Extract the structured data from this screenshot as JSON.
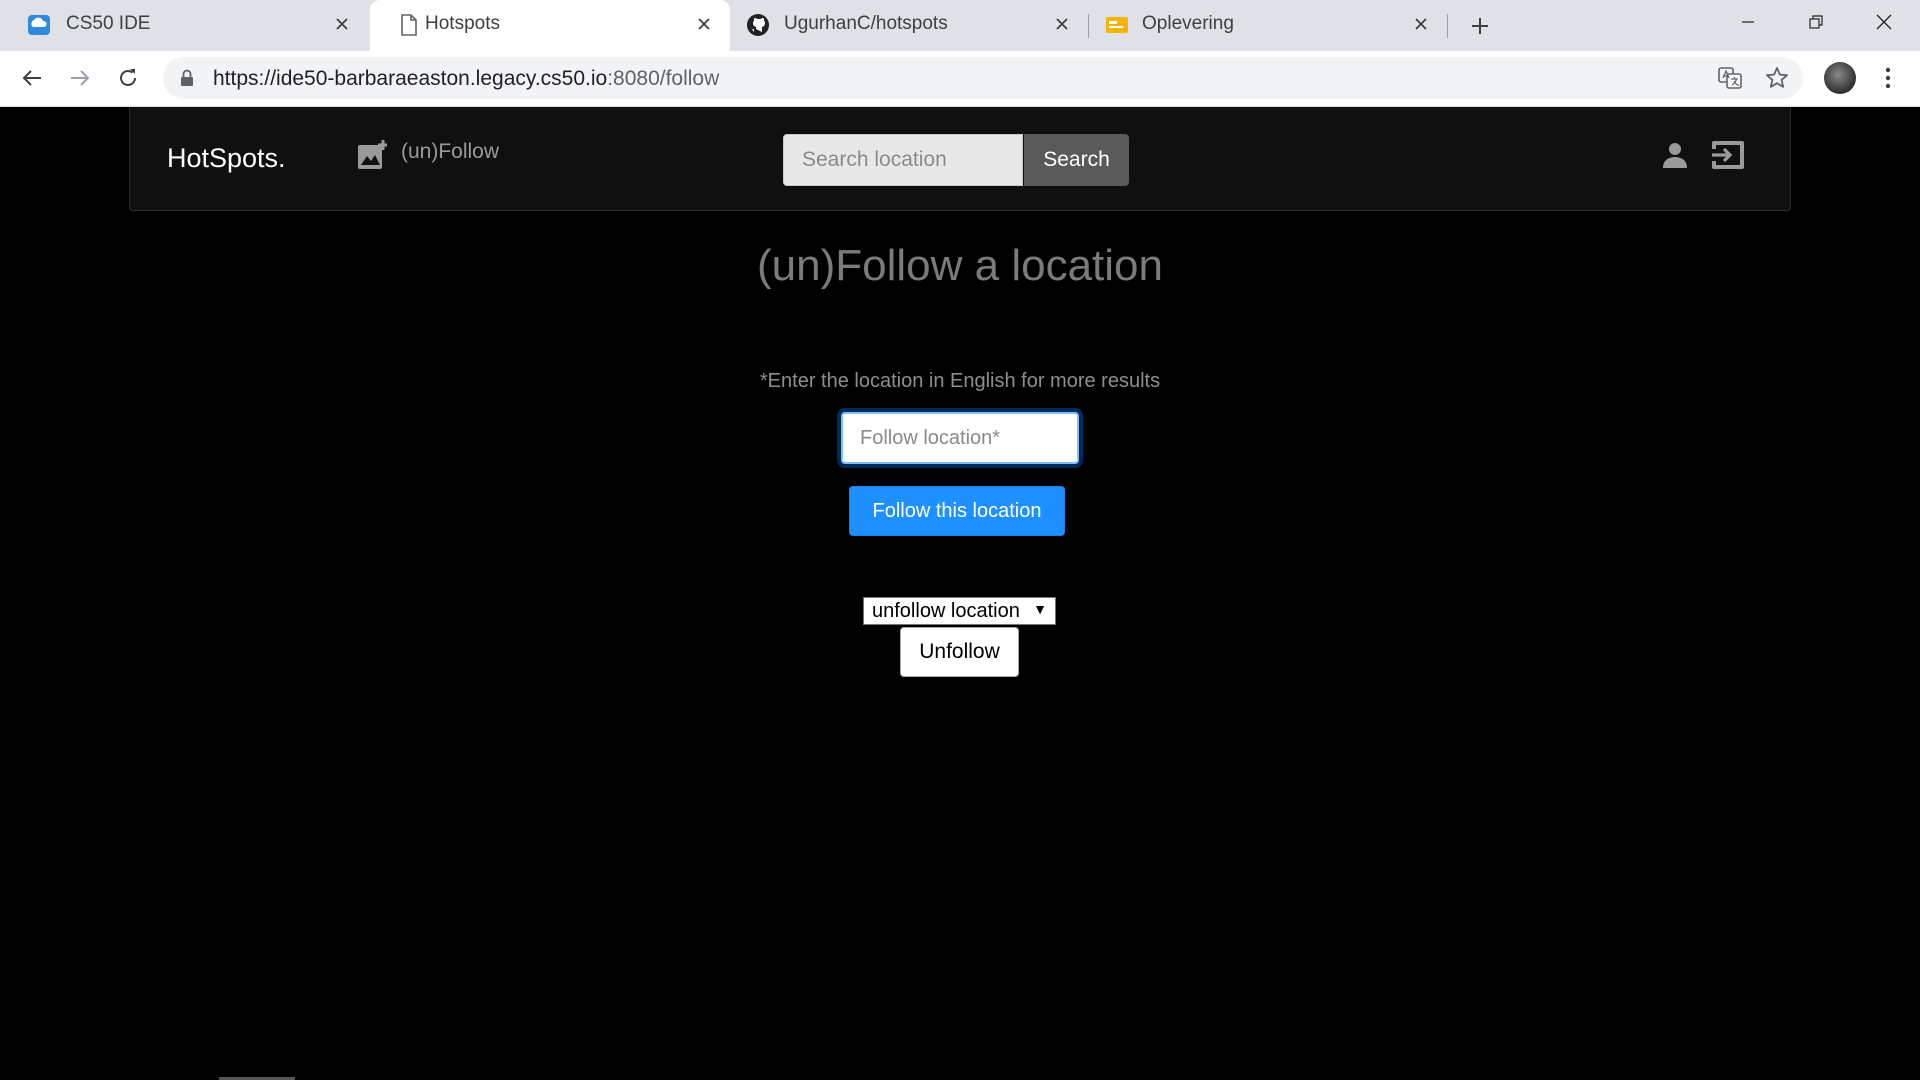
{
  "browser": {
    "tabs": [
      {
        "title": "CS50 IDE",
        "icon": "cs50-ide-icon",
        "active": false
      },
      {
        "title": "Hotspots",
        "icon": "page-icon",
        "active": true
      },
      {
        "title": "UgurhanC/hotspots",
        "icon": "github-icon",
        "active": false
      },
      {
        "title": "Oplevering",
        "icon": "oplevering-icon",
        "active": false
      }
    ],
    "address": {
      "url_main": "https://ide50-barbaraeaston.legacy.cs50.io",
      "url_rest": ":8080/follow"
    }
  },
  "app": {
    "brand": "HotSpots.",
    "nav_follow_label": "(un)Follow",
    "search": {
      "placeholder": "Search location",
      "value": "",
      "button_label": "Search"
    },
    "heading": "(un)Follow a location",
    "hint": "*Enter the location in English for more results",
    "follow_input": {
      "placeholder": "Follow location*",
      "value": ""
    },
    "follow_button_label": "Follow this location",
    "unfollow_select_value": "unfollow location",
    "unfollow_button_label": "Unfollow"
  },
  "colors": {
    "accent": "#1e90ff",
    "page_background": "#000000",
    "navbar_background": "#101010"
  }
}
